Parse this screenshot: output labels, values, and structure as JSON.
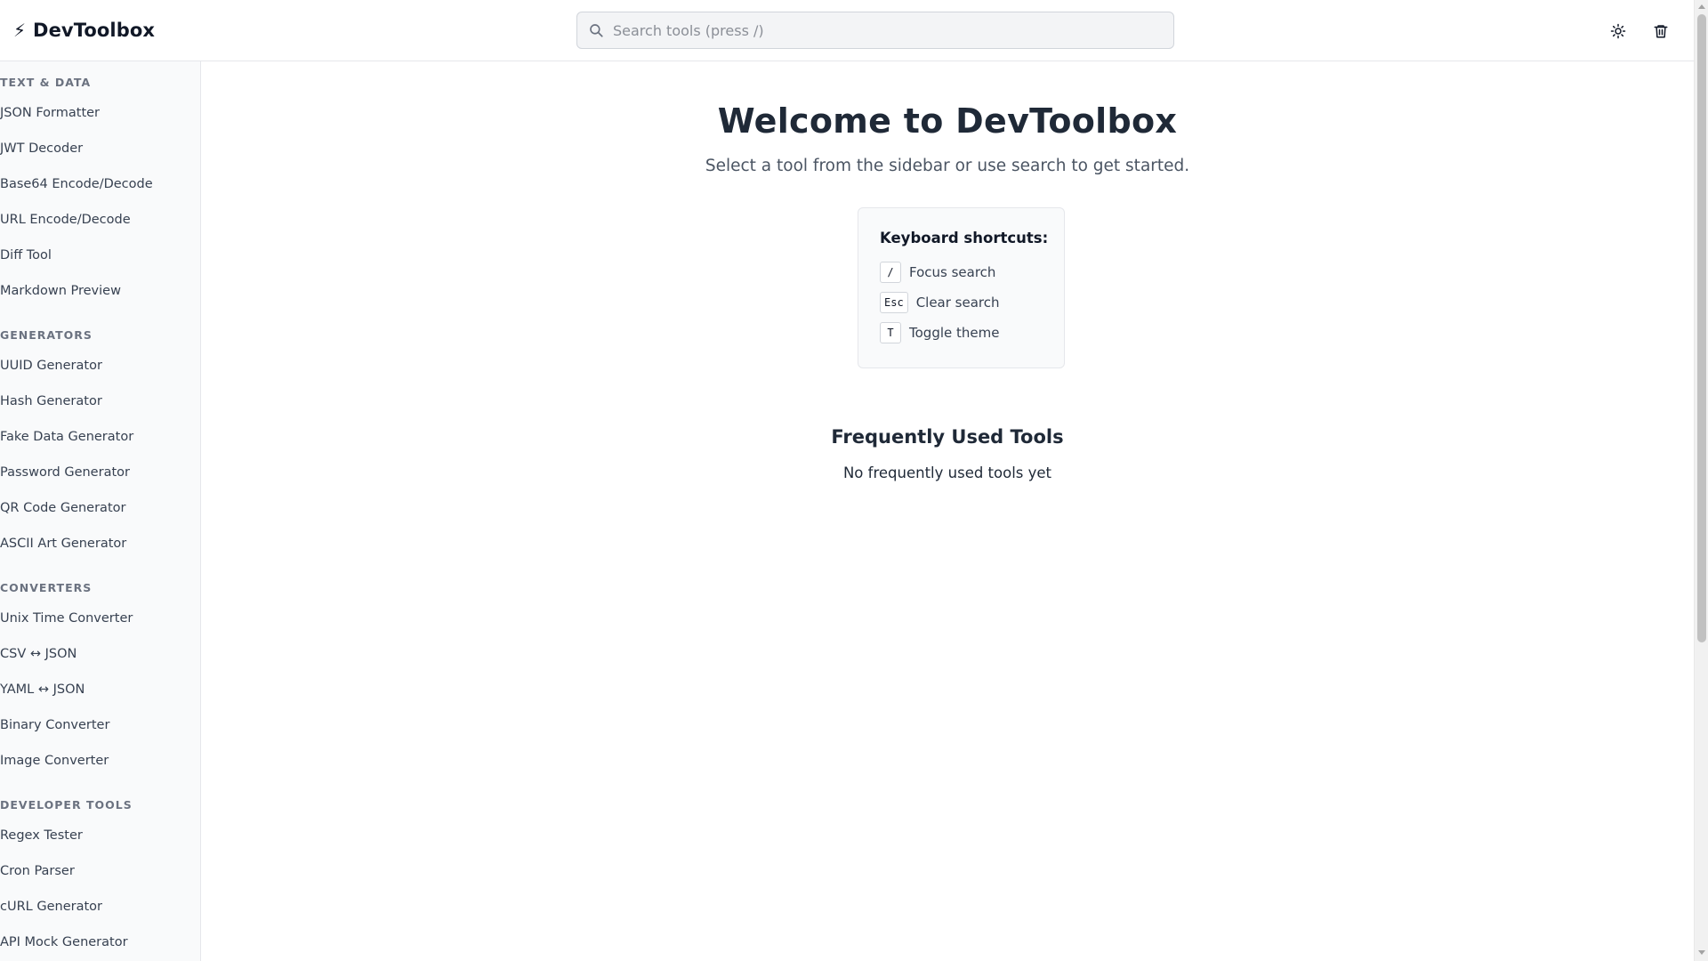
{
  "header": {
    "brand_icon": "⚡",
    "brand_name": "DevToolbox",
    "search_placeholder": "Search tools (press /)",
    "search_value": "",
    "theme_toggle_icon": "sun-icon",
    "clear_icon": "trash-icon"
  },
  "sidebar": {
    "sections": [
      {
        "title": "TEXT & DATA",
        "items": [
          "JSON Formatter",
          "JWT Decoder",
          "Base64 Encode/Decode",
          "URL Encode/Decode",
          "Diff Tool",
          "Markdown Preview"
        ]
      },
      {
        "title": "GENERATORS",
        "items": [
          "UUID Generator",
          "Hash Generator",
          "Fake Data Generator",
          "Password Generator",
          "QR Code Generator",
          "ASCII Art Generator"
        ]
      },
      {
        "title": "CONVERTERS",
        "items": [
          "Unix Time Converter",
          "CSV ↔ JSON",
          "YAML ↔ JSON",
          "Binary Converter",
          "Image Converter"
        ]
      },
      {
        "title": "DEVELOPER TOOLS",
        "items": [
          "Regex Tester",
          "Cron Parser",
          "cURL Generator",
          "API Mock Generator"
        ]
      }
    ]
  },
  "main": {
    "welcome_title": "Welcome to DevToolbox",
    "subtitle": "Select a tool from the sidebar or use search to get started.",
    "shortcuts": {
      "title": "Keyboard shortcuts:",
      "items": [
        {
          "key": "/",
          "label": "Focus search"
        },
        {
          "key": "Esc",
          "label": "Clear search"
        },
        {
          "key": "T",
          "label": "Toggle theme"
        }
      ]
    },
    "frequent": {
      "title": "Frequently Used Tools",
      "empty_text": "No frequently used tools yet"
    }
  },
  "colors": {
    "accent_text": "#111827",
    "muted_text": "#6b7280",
    "border": "#e5e7eb",
    "sidebar_bg": "#f9fafb"
  }
}
